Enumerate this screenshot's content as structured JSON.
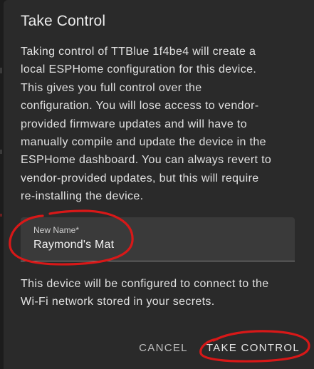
{
  "dialog": {
    "title": "Take Control",
    "description_lines": [
      "Taking control of TTBlue 1f4be4 will create a",
      "local ESPHome configuration for this device.",
      "This gives you full control over the",
      "configuration. You will lose access to vendor-",
      "provided firmware updates and will have to",
      "manually compile and update the device in the",
      "ESPHome dashboard. You can always revert to",
      "vendor-provided updates, but this will require",
      "re-installing the device."
    ],
    "name_field": {
      "label": "New Name*",
      "value": "Raymond's Mat"
    },
    "note_lines": [
      "This device will be configured to connect to the",
      "Wi-Fi network stored in your secrets."
    ],
    "actions": {
      "cancel_label": "CANCEL",
      "confirm_label": "TAKE CONTROL"
    }
  },
  "colors": {
    "dialog_bg": "#2a2a2a",
    "field_bg": "#3a3a3a",
    "annotation": "#d81818"
  }
}
